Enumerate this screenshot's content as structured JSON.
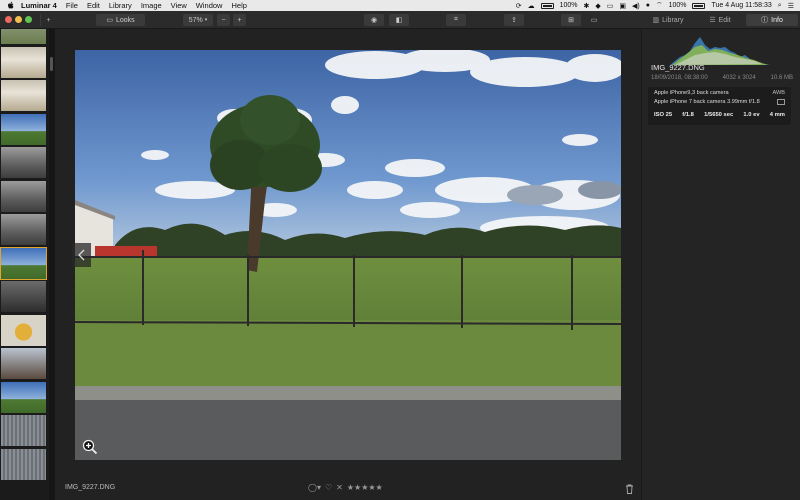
{
  "menubar": {
    "app_name": "Luminar 4",
    "menus": [
      "File",
      "Edit",
      "Library",
      "Image",
      "View",
      "Window",
      "Help"
    ],
    "battery_left": "100%",
    "battery_right": "100%",
    "clock": "Tue 4 Aug  11:58:33"
  },
  "toolbar": {
    "looks_label": "Looks",
    "zoom_value": "57%",
    "zoom_out": "−",
    "zoom_in": "+",
    "add": "+"
  },
  "tabs": [
    {
      "label": "Library",
      "icon": "library-icon",
      "active": false
    },
    {
      "label": "Edit",
      "icon": "sliders-icon",
      "active": false
    },
    {
      "label": "Info",
      "icon": "info-icon",
      "active": true
    }
  ],
  "filmstrip": [
    {
      "kind": "grass"
    },
    {
      "kind": "docs"
    },
    {
      "kind": "docs"
    },
    {
      "kind": "tree"
    },
    {
      "kind": "cloud"
    },
    {
      "kind": "cloud"
    },
    {
      "kind": "cloud"
    },
    {
      "kind": "tree",
      "selected": true
    },
    {
      "kind": "cloud-dark"
    },
    {
      "kind": "lemon"
    },
    {
      "kind": "street"
    },
    {
      "kind": "tree"
    },
    {
      "kind": "metal"
    },
    {
      "kind": "metal"
    }
  ],
  "viewer": {
    "filename": "IMG_9227.DNG"
  },
  "info": {
    "filename": "IMG_9227.DNG",
    "datetime": "18/09/2018, 08:38:00",
    "dimensions": "4032 x 3024",
    "filesize": "10.6 MB",
    "camera": "Apple iPhone9,3 back camera",
    "lens": "Apple iPhone 7 back camera 3.99mm f/1.8",
    "white_balance": "AWB",
    "iso": "ISO 25",
    "aperture": "f/1.8",
    "shutter": "1/5650 sec",
    "exposure": "1.0 ev",
    "focal": "4 mm"
  },
  "rating": {
    "stars": 0,
    "max": 5
  },
  "colors": {
    "accent_selected": "#e0a52a",
    "panel_bg": "#242424",
    "viewer_bg": "#222222"
  }
}
